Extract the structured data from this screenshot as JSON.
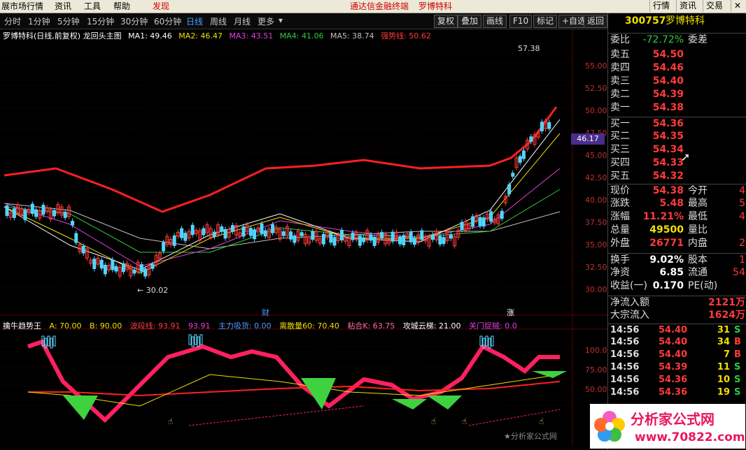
{
  "menubar": {
    "items": [
      "展市场行情",
      "资讯",
      "工具",
      "帮助",
      "发现"
    ],
    "center_title": "通达信金融终端",
    "center_stock": "罗博特科",
    "right_buttons": [
      "行情",
      "资讯",
      "交易"
    ]
  },
  "periodbar": {
    "periods": [
      "分时",
      "1分钟",
      "5分钟",
      "15分钟",
      "30分钟",
      "60分钟",
      "日线",
      "周线",
      "月线",
      "更多"
    ],
    "active": "日线",
    "tools": [
      "复权",
      "叠加",
      "画线",
      "F10",
      "标记",
      "+自选",
      "返回"
    ]
  },
  "main_legend": {
    "title": "罗博特科(日线,前复权) 龙回头主图",
    "ma1": "MA1: 49.46",
    "ma2": "MA2: 46.47",
    "ma3": "MA3: 43.51",
    "ma4": "MA4: 41.06",
    "ma5": "MA5: 38.74",
    "strong": "强势线: 50.62"
  },
  "price_axis": [
    "55.00",
    "52.50",
    "50.00",
    "47.50",
    "45.00",
    "42.50",
    "40.00",
    "37.50",
    "35.00",
    "32.50",
    "30.00"
  ],
  "current_price_tag": "46.17",
  "high_marker": "57.38",
  "low_marker": "30.02",
  "event_markers": [
    "财",
    "涨"
  ],
  "indicator_legend": {
    "name": "擒牛趋势王",
    "a": "A: 70.00",
    "b": "B: 90.00",
    "wave": "波段线: 93.91",
    "wave2": "93.91",
    "main_absorb": "主力吸货: 0.00",
    "divergence": "离散量60: 70.40",
    "stick": "粘合K: 63.75",
    "ladder": "攻城云梯: 21.00",
    "gate": "关门捉贼: 0.0"
  },
  "indicator_axis": [
    "100.0",
    "75.00",
    "50.00"
  ],
  "quote": {
    "code": "300757",
    "name": "罗博特科",
    "weibi_label": "委比",
    "weibi_value": "-72.72%",
    "weicha_label": "委差",
    "asks": [
      {
        "label": "卖五",
        "price": "54.50"
      },
      {
        "label": "卖四",
        "price": "54.46"
      },
      {
        "label": "卖三",
        "price": "54.40"
      },
      {
        "label": "卖二",
        "price": "54.39"
      },
      {
        "label": "卖一",
        "price": "54.38"
      }
    ],
    "bids": [
      {
        "label": "买一",
        "price": "54.36"
      },
      {
        "label": "买二",
        "price": "54.35"
      },
      {
        "label": "买三",
        "price": "54.34"
      },
      {
        "label": "买四",
        "price": "54.33"
      },
      {
        "label": "买五",
        "price": "54.32"
      }
    ],
    "stats": [
      {
        "l": "现价",
        "v": "54.38",
        "l2": "今开",
        "v2": "4"
      },
      {
        "l": "涨跌",
        "v": "5.48",
        "l2": "最高",
        "v2": "5"
      },
      {
        "l": "涨幅",
        "v": "11.21%",
        "l2": "最低",
        "v2": "4"
      },
      {
        "l": "总量",
        "v": "49500",
        "l2": "量比",
        "v2": ""
      },
      {
        "l": "外盘",
        "v": "26771",
        "l2": "内盘",
        "v2": "2"
      },
      {
        "l": "换手",
        "v": "9.02%",
        "l2": "股本",
        "v2": "1"
      },
      {
        "l": "净资",
        "v": "6.85",
        "l2": "流通",
        "v2": "54"
      },
      {
        "l": "收益(一)",
        "v": "0.170",
        "l2": "PE(动)",
        "v2": ""
      }
    ],
    "flow": [
      {
        "l": "净流入额",
        "v": "2121万"
      },
      {
        "l": "大宗流入",
        "v": "1624万"
      }
    ],
    "trades": [
      {
        "t": "14:56",
        "p": "54.40",
        "v": "31",
        "s": "S"
      },
      {
        "t": "14:56",
        "p": "54.40",
        "v": "34",
        "s": "B"
      },
      {
        "t": "14:56",
        "p": "54.40",
        "v": "7",
        "s": "B"
      },
      {
        "t": "14:56",
        "p": "54.39",
        "v": "11",
        "s": "S"
      },
      {
        "t": "14:56",
        "p": "54.36",
        "v": "10",
        "s": "S"
      },
      {
        "t": "14:56",
        "p": "54.36",
        "v": "19",
        "s": "S"
      }
    ]
  },
  "watermark": "★分析家公式网",
  "logo": {
    "line1": "分析家公式网",
    "line2": "www.70822.com"
  },
  "colors": {
    "up": "#ff3a3a",
    "down": "#4fd6ff",
    "ma1": "#ffffff",
    "ma2": "#f0e000",
    "ma3": "#e040e0",
    "ma4": "#2ecc40",
    "ma5": "#c0c0c0",
    "strong": "#ff2020",
    "accent": "#4a9dff"
  }
}
